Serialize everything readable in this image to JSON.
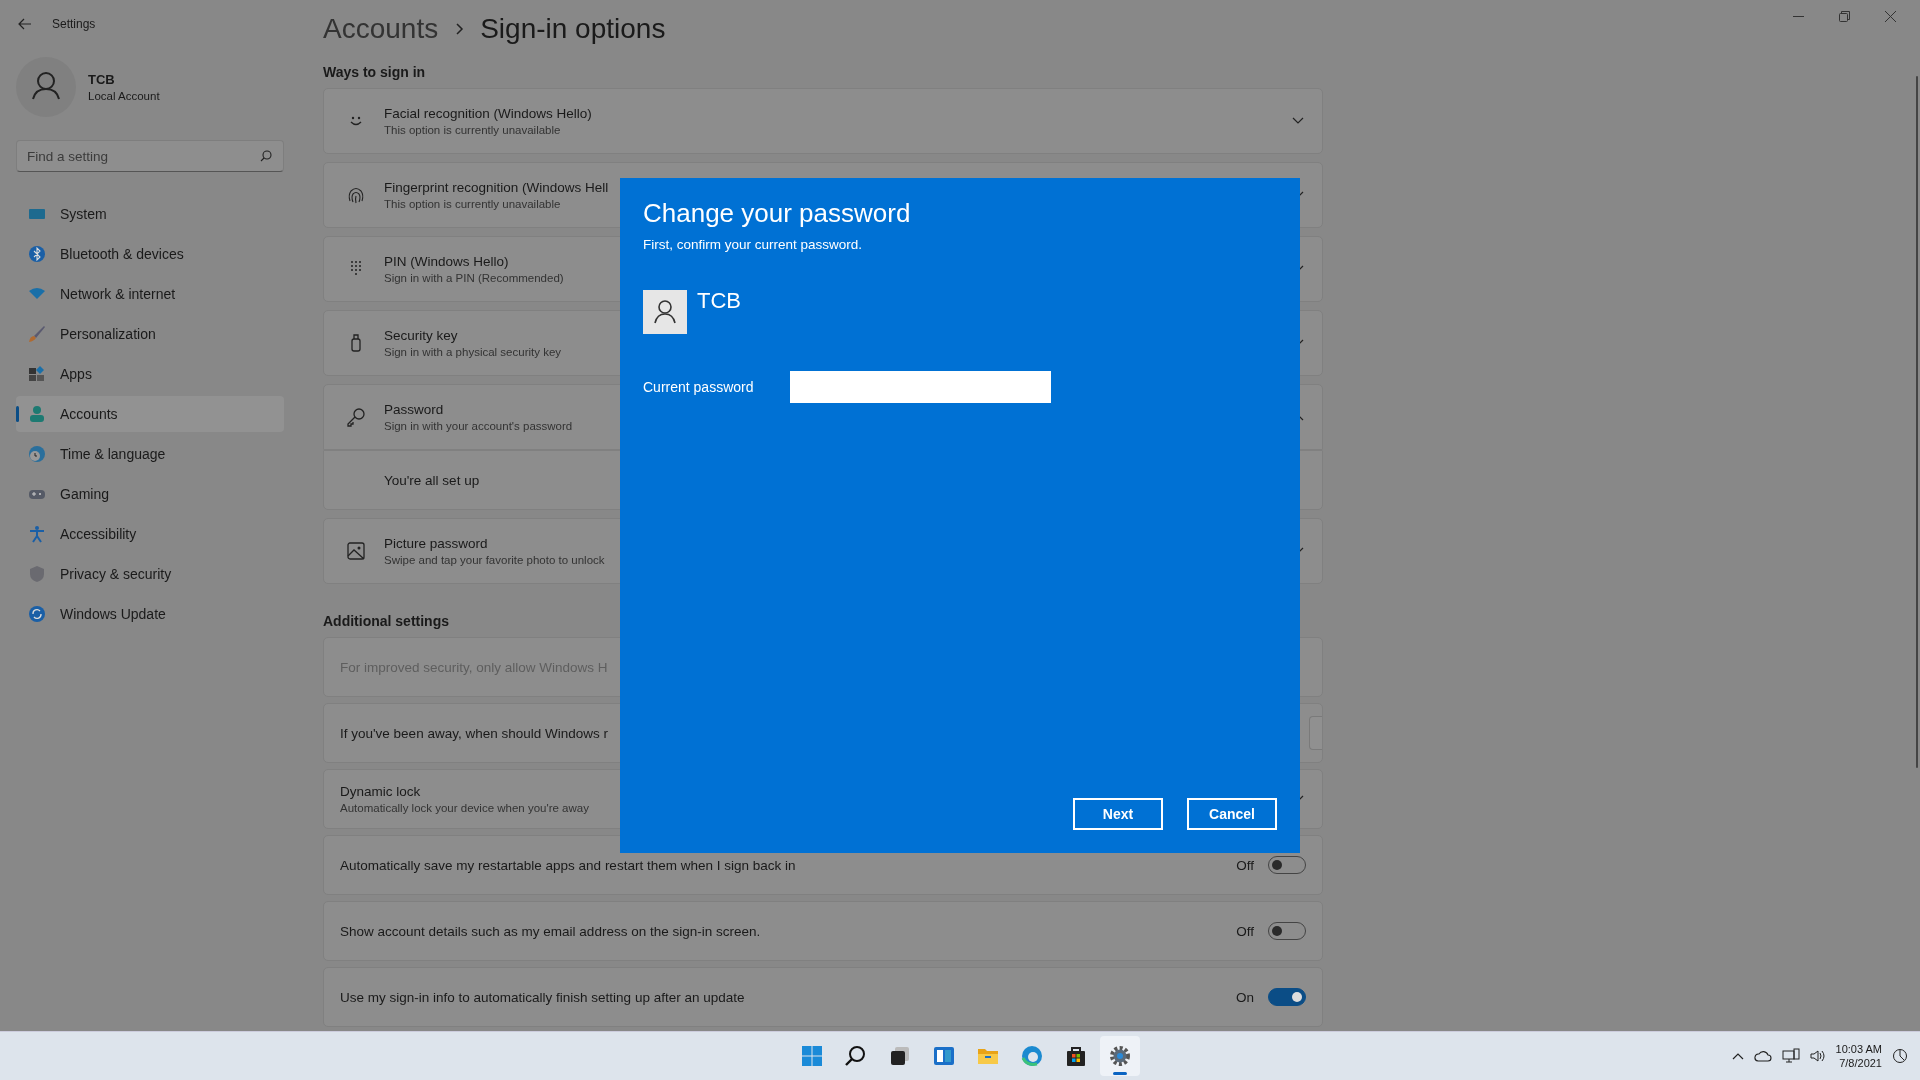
{
  "window": {
    "title": "Settings"
  },
  "profile": {
    "name": "TCB",
    "account_type": "Local Account"
  },
  "search": {
    "placeholder": "Find a setting"
  },
  "nav": [
    {
      "label": "System",
      "selected": false
    },
    {
      "label": "Bluetooth & devices",
      "selected": false
    },
    {
      "label": "Network & internet",
      "selected": false
    },
    {
      "label": "Personalization",
      "selected": false
    },
    {
      "label": "Apps",
      "selected": false
    },
    {
      "label": "Accounts",
      "selected": true
    },
    {
      "label": "Time & language",
      "selected": false
    },
    {
      "label": "Gaming",
      "selected": false
    },
    {
      "label": "Accessibility",
      "selected": false
    },
    {
      "label": "Privacy & security",
      "selected": false
    },
    {
      "label": "Windows Update",
      "selected": false
    }
  ],
  "breadcrumb": {
    "parent": "Accounts",
    "current": "Sign-in options"
  },
  "ways_to_sign_in": {
    "heading": "Ways to sign in",
    "items": [
      {
        "title": "Facial recognition (Windows Hello)",
        "subtitle": "This option is currently unavailable",
        "expanded": false
      },
      {
        "title": "Fingerprint recognition (Windows Hell",
        "subtitle": "This option is currently unavailable",
        "expanded": false
      },
      {
        "title": "PIN (Windows Hello)",
        "subtitle": "Sign in with a PIN (Recommended)",
        "expanded": false
      },
      {
        "title": "Security key",
        "subtitle": "Sign in with a physical security key",
        "expanded": false
      },
      {
        "title": "Password",
        "subtitle": "Sign in with your account's password",
        "expanded": true,
        "detail": "You're all set up"
      },
      {
        "title": "Picture password",
        "subtitle": "Swipe and tap your favorite photo to unlock",
        "expanded": false
      }
    ]
  },
  "additional_settings": {
    "heading": "Additional settings",
    "items": [
      {
        "kind": "text",
        "text": "For improved security, only allow Windows H",
        "disabled": true
      },
      {
        "kind": "dropdown",
        "text": "If you've been away, when should Windows r",
        "disabled": false
      },
      {
        "kind": "expander",
        "text": "Dynamic lock",
        "subtitle": "Automatically lock your device when you're away",
        "disabled": false
      },
      {
        "kind": "toggle",
        "text": "Automatically save my restartable apps and restart them when I sign back in",
        "state": "Off",
        "on": false,
        "disabled": false
      },
      {
        "kind": "toggle",
        "text": "Show account details such as my email address on the sign-in screen.",
        "state": "Off",
        "on": false,
        "disabled": false
      },
      {
        "kind": "toggle",
        "text": "Use my sign-in info to automatically finish setting up after an update",
        "state": "On",
        "on": true,
        "disabled": false
      }
    ]
  },
  "dialog": {
    "title": "Change your password",
    "subtitle": "First, confirm your current password.",
    "user": "TCB",
    "field_label": "Current password",
    "buttons": [
      {
        "label": "Next"
      },
      {
        "label": "Cancel"
      }
    ]
  },
  "taskbar": {
    "apps": [
      {
        "active": false
      },
      {
        "active": false
      },
      {
        "active": false
      },
      {
        "active": false
      },
      {
        "active": false
      },
      {
        "active": false
      },
      {
        "active": false
      },
      {
        "active": true
      }
    ],
    "time": "10:03 AM",
    "date": "7/8/2021"
  }
}
